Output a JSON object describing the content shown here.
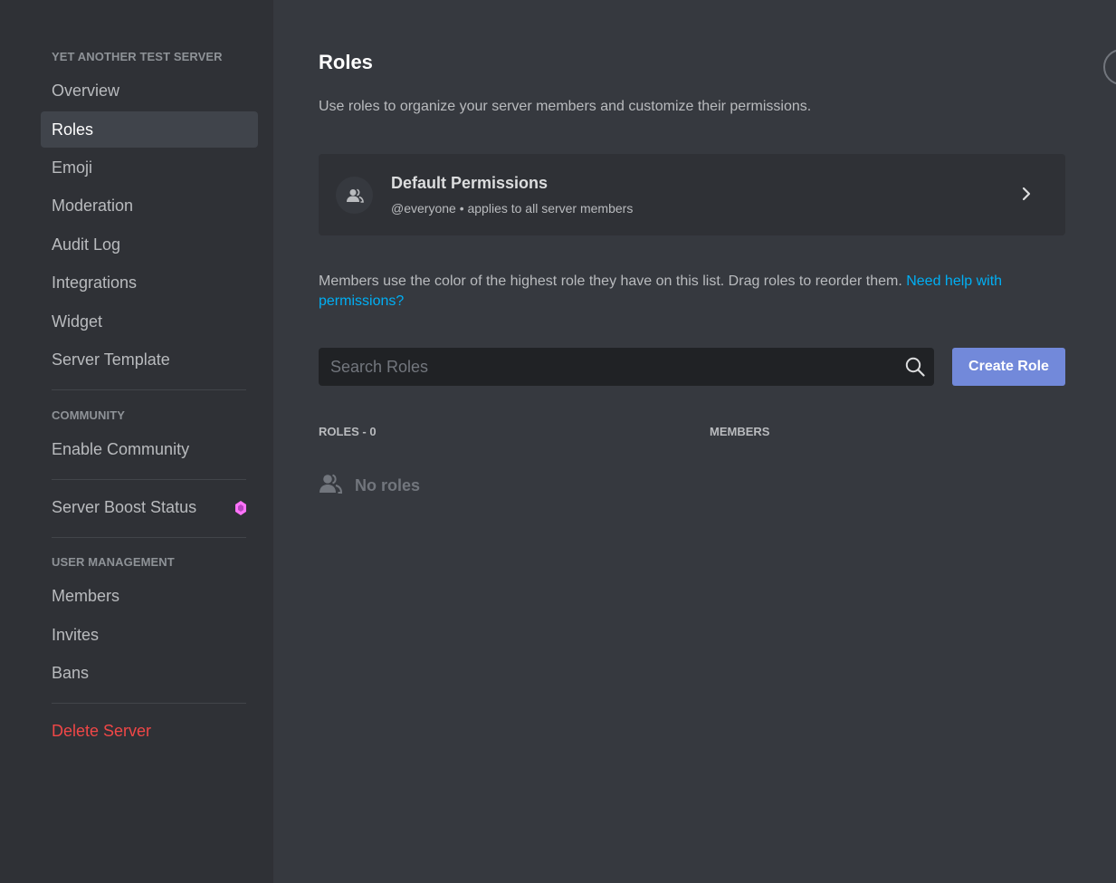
{
  "sidebar": {
    "server_header": "YET ANOTHER TEST SERVER",
    "server_items": [
      {
        "label": "Overview"
      },
      {
        "label": "Roles"
      },
      {
        "label": "Emoji"
      },
      {
        "label": "Moderation"
      },
      {
        "label": "Audit Log"
      },
      {
        "label": "Integrations"
      },
      {
        "label": "Widget"
      },
      {
        "label": "Server Template"
      }
    ],
    "community_header": "COMMUNITY",
    "community_items": [
      {
        "label": "Enable Community"
      }
    ],
    "boost_label": "Server Boost Status",
    "user_mgmt_header": "USER MANAGEMENT",
    "user_mgmt_items": [
      {
        "label": "Members"
      },
      {
        "label": "Invites"
      },
      {
        "label": "Bans"
      }
    ],
    "delete_label": "Delete Server"
  },
  "main": {
    "title": "Roles",
    "description": "Use roles to organize your server members and customize their permissions.",
    "default_card": {
      "title": "Default Permissions",
      "subtitle": "@everyone • applies to all server members"
    },
    "info_text": "Members use the color of the highest role they have on this list. Drag roles to reorder them.",
    "help_link": "Need help with permissions?",
    "search": {
      "placeholder": "Search Roles",
      "value": ""
    },
    "create_button": "Create Role",
    "roles_column": "ROLES - 0",
    "members_column": "MEMBERS",
    "empty_label": "No roles"
  },
  "colors": {
    "accent": "#7289da",
    "link": "#00aff4",
    "danger": "#f04747",
    "boost": "#ff73fa"
  },
  "icons": {
    "card_avatar": "people-icon",
    "card_chevron": "chevron-right-icon",
    "search": "search-icon",
    "empty": "people-icon",
    "boost": "boost-gem-icon"
  }
}
